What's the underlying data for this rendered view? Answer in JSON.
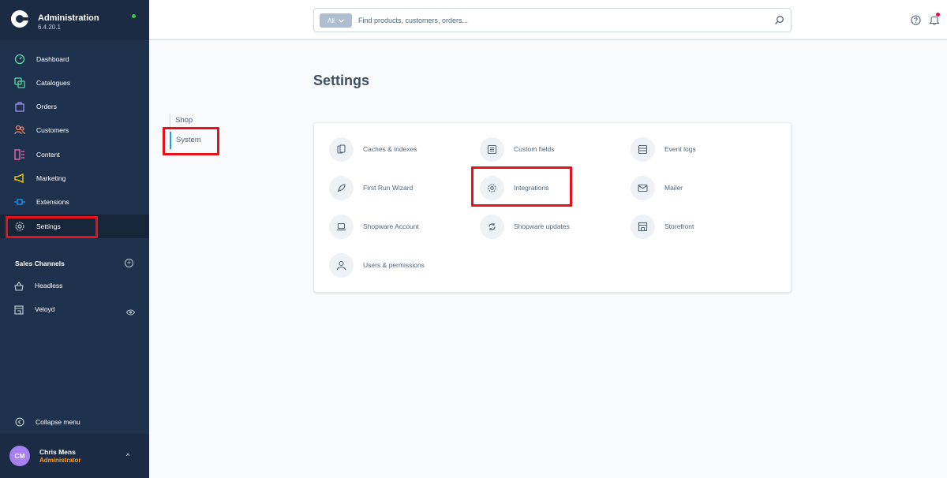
{
  "app": {
    "title": "Administration",
    "version": "6.4.20.1"
  },
  "sidebar": {
    "items": [
      {
        "label": "Dashboard",
        "icon": "dashboard-icon",
        "color": "#57d9a3"
      },
      {
        "label": "Catalogues",
        "icon": "catalogue-icon",
        "color": "#57d9a3"
      },
      {
        "label": "Orders",
        "icon": "orders-icon",
        "color": "#a092f0"
      },
      {
        "label": "Customers",
        "icon": "customers-icon",
        "color": "#f88962"
      },
      {
        "label": "Content",
        "icon": "content-icon",
        "color": "#ff68b4"
      },
      {
        "label": "Marketing",
        "icon": "marketing-icon",
        "color": "#ffd700"
      },
      {
        "label": "Extensions",
        "icon": "extensions-icon",
        "color": "#189eff"
      },
      {
        "label": "Settings",
        "icon": "settings-icon",
        "color": "#9aa8b5"
      }
    ],
    "sales_channels_title": "Sales Channels",
    "sales_channels": [
      {
        "label": "Headless",
        "icon": "basket-icon"
      },
      {
        "label": "Veloyd",
        "icon": "storefront-icon"
      }
    ],
    "collapse_label": "Collapse menu",
    "user": {
      "initials": "CM",
      "name": "Chris Mens",
      "role": "Administrator"
    }
  },
  "header": {
    "search_type": "All",
    "search_placeholder": "Find products, customers, orders..."
  },
  "page": {
    "title": "Settings",
    "subnav": [
      "Shop",
      "System"
    ],
    "tiles": [
      {
        "label": "Caches & indexes",
        "icon": "cache-icon"
      },
      {
        "label": "Custom fields",
        "icon": "custom-fields-icon"
      },
      {
        "label": "Event logs",
        "icon": "event-logs-icon"
      },
      {
        "label": "First Run Wizard",
        "icon": "rocket-icon"
      },
      {
        "label": "Integrations",
        "icon": "gear-icon"
      },
      {
        "label": "Mailer",
        "icon": "mail-icon"
      },
      {
        "label": "Shopware Account",
        "icon": "laptop-icon"
      },
      {
        "label": "Shopware updates",
        "icon": "refresh-icon"
      },
      {
        "label": "Storefront",
        "icon": "storefront-icon"
      },
      {
        "label": "Users & permissions",
        "icon": "user-icon"
      }
    ]
  },
  "colors": {
    "sidebar_bg": "#1f324d",
    "accent": "#189eff",
    "highlight": "#e8101a"
  }
}
